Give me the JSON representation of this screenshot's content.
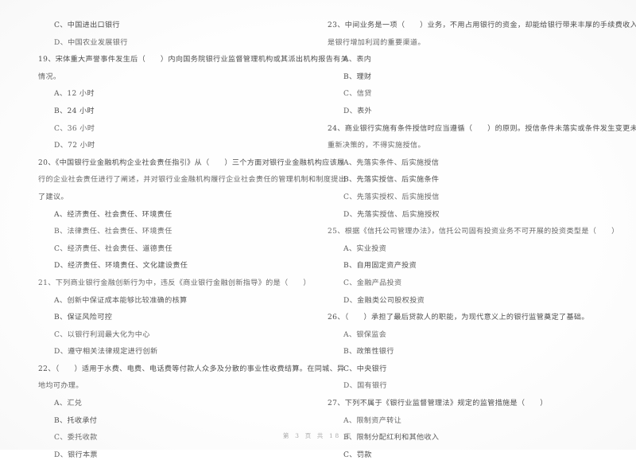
{
  "document": {
    "type": "scanned-exam-paper",
    "subject_language": "zh-CN",
    "footer": "第 3 页 共 18 页",
    "ink_color": "#4a4a4a",
    "page_color": "#ffffff"
  },
  "left_column": {
    "top_orphan_options": [
      "C、中国进出口银行",
      "D、中国农业发展银行"
    ],
    "questions": [
      {
        "number": "19",
        "stem_lines": [
          "19、宋体重大声誉事件发生后（　　）内向国务院银行业监督管理机构或其派出机构报告有关",
          "情况。"
        ],
        "options": [
          "A、12 小时",
          "B、24 小时",
          "C、36 小时",
          "D、72 小时"
        ]
      },
      {
        "number": "20",
        "stem_lines": [
          "20、《中国银行业金融机构企业社会责任指引》从（　　）三个方面对银行业金融机构应该履",
          "行的企业社会责任进行了阐述，并对银行业金融机构履行企业社会责任的管理机制和制度提出",
          "了建议。"
        ],
        "options": [
          "A、经济责任、社会责任、环境责任",
          "B、法律责任、社会责任、环境责任",
          "C、经济责任、社会责任、道德责任",
          "D、经济责任、环境责任、文化建设责任"
        ]
      },
      {
        "number": "21",
        "stem_lines": [
          "21、下列商业银行金融创新行为中，违反《商业银行金融创新指导》的是（　　）"
        ],
        "options": [
          "A、创新中保证成本能够比较准确的核算",
          "B、保证风险可控",
          "C、以银行利润最大化为中心",
          "D、遵守相关法律规定进行创新"
        ]
      },
      {
        "number": "22",
        "stem_lines": [
          "22、（　　）适用于水费、电费、电话费等付款人众多及分散的事业性收费结算。在同城、异",
          "地均可办理。"
        ],
        "options": [
          "A、汇兑",
          "B、托收承付",
          "C、委托收款",
          "D、银行本票"
        ]
      }
    ]
  },
  "right_column": {
    "questions": [
      {
        "number": "23",
        "stem_lines": [
          "23、中间业务是一项（　　）业务，不用占用银行的资金，却能给银行带来丰厚的手续费收入，",
          "是银行增加利润的重要渠道。"
        ],
        "options": [
          "A、表内",
          "B、理财",
          "C、信贷",
          "D、表外"
        ]
      },
      {
        "number": "24",
        "stem_lines": [
          "24、商业银行实施有条件授信时应当遵循（　　）的原则。授信条件未落实或条件发生变更未",
          "重新决策的，不得实施授信。"
        ],
        "options": [
          "A、先落实条件、后实施授信",
          "B、先落实授信、后实施条件",
          "C、先落实授权、后实施授信",
          "D、先落实授信、后实施授权"
        ]
      },
      {
        "number": "25",
        "stem_lines": [
          "25、根据《信托公司管理办法》，信托公司固有投资业务不可开展的投资类型是（　　）"
        ],
        "options": [
          "A、实业投资",
          "B、自用固定资产投资",
          "C、金融产品投资",
          "D、金融类公司股权投资"
        ]
      },
      {
        "number": "26",
        "stem_lines": [
          "26、（　　）承担了最后贷款人的职能，为现代意义上的银行监管奠定了基础。"
        ],
        "options": [
          "A、银保监会",
          "B、政策性银行",
          "C、中央银行",
          "D、国有银行"
        ]
      },
      {
        "number": "27",
        "stem_lines": [
          "27、下列不属于《银行业监督管理法》规定的监管措施是（　　）"
        ],
        "options": [
          "A、限制资产转让",
          "B、限制分配红利和其他收入",
          "C、罚款"
        ]
      }
    ]
  }
}
